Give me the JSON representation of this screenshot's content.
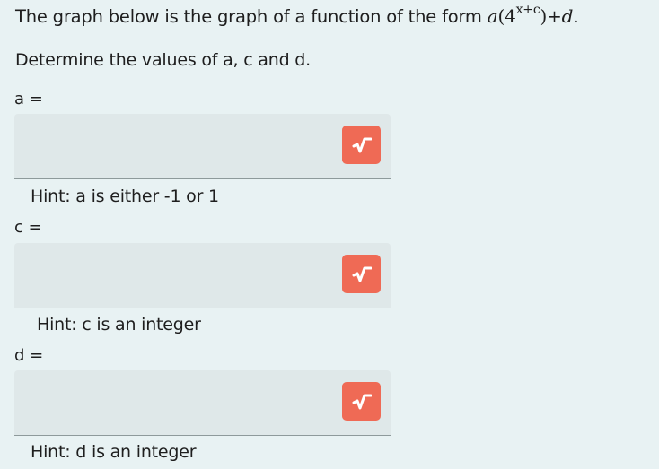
{
  "question": {
    "prompt_text": "The graph below is the graph of a function of the form",
    "formula": {
      "a": "a",
      "open": "(4",
      "exponent": "x+c",
      "close": ")+",
      "d": "d",
      "end": "."
    },
    "instruction": "Determine the values of a, c and d."
  },
  "fields": [
    {
      "label": "a =",
      "value": "",
      "button_icon": "sqrt-icon",
      "hint": "Hint: a is either -1 or 1"
    },
    {
      "label": "c =",
      "value": "",
      "button_icon": "sqrt-icon",
      "hint": "Hint: c is an integer"
    },
    {
      "label": "d =",
      "value": "",
      "button_icon": "sqrt-icon",
      "hint": "Hint: d is an integer"
    }
  ],
  "colors": {
    "background": "#e8f2f3",
    "input_background": "#dfe8e9",
    "button_accent": "#ef6a55"
  }
}
